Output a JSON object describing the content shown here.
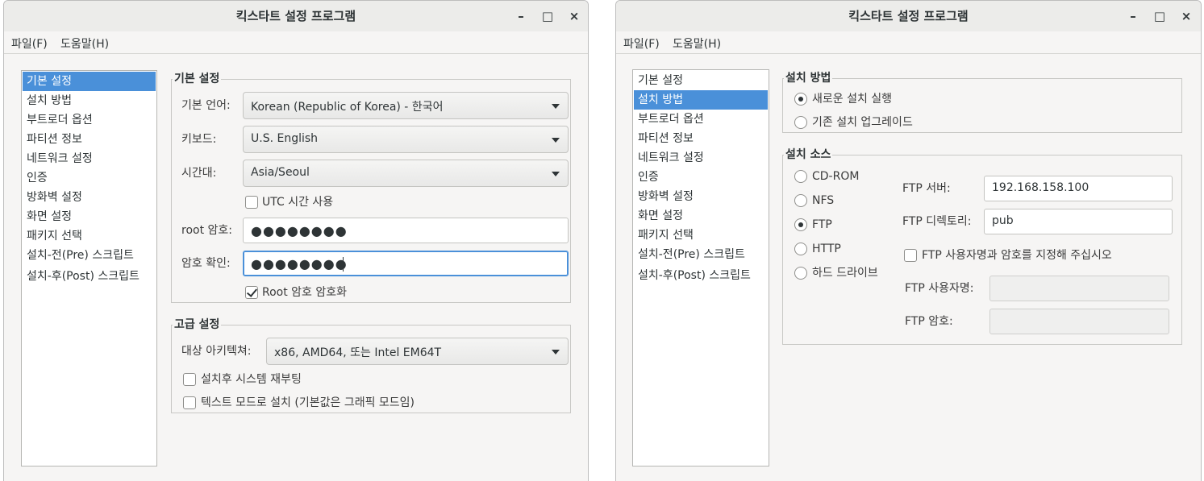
{
  "left_window": {
    "title": "킥스타트 설정 프로그램",
    "controls": {
      "minimize": "–",
      "maximize": "□",
      "close": "×"
    },
    "menu": [
      "파일(F)",
      "도움말(H)"
    ],
    "sidebar": [
      {
        "label": "기본 설정",
        "selected": true
      },
      {
        "label": "설치 방법"
      },
      {
        "label": "부트로더 옵션"
      },
      {
        "label": "파티션 정보"
      },
      {
        "label": "네트워크 설정"
      },
      {
        "label": "인증"
      },
      {
        "label": "방화벽 설정"
      },
      {
        "label": "화면 설정"
      },
      {
        "label": "패키지 선택"
      },
      {
        "label": "설치-전(Pre) 스크립트"
      },
      {
        "label": "설치-후(Post) 스크립트"
      }
    ],
    "basic": {
      "title": "기본 설정",
      "language_label": "기본 언어:",
      "language_value": "Korean (Republic of Korea) - 한국어",
      "keyboard_label": "키보드:",
      "keyboard_value": "U.S. English",
      "timezone_label": "시간대:",
      "timezone_value": "Asia/Seoul",
      "utc_label": "UTC 시간 사용",
      "utc_checked": false,
      "root_pw_label": "root 암호:",
      "root_pw_value": "●●●●●●●●",
      "confirm_pw_label": "암호 확인:",
      "confirm_pw_value": "●●●●●●●●",
      "encrypt_label": "Root 암호 암호화",
      "encrypt_checked": true
    },
    "advanced": {
      "title": "고급 설정",
      "arch_label": "대상 아키텍쳐:",
      "arch_value": "x86, AMD64, 또는 Intel EM64T",
      "reboot_label": "설치후 시스템 재부팅",
      "reboot_checked": false,
      "text_mode_label": "텍스트 모드로 설치 (기본값은 그래픽 모드임)",
      "text_mode_checked": false
    }
  },
  "right_window": {
    "title": "킥스타트 설정 프로그램",
    "controls": {
      "minimize": "–",
      "maximize": "□",
      "close": "×"
    },
    "menu": [
      "파일(F)",
      "도움말(H)"
    ],
    "sidebar": [
      {
        "label": "기본 설정"
      },
      {
        "label": "설치 방법",
        "selected": true
      },
      {
        "label": "부트로더 옵션"
      },
      {
        "label": "파티션 정보"
      },
      {
        "label": "네트워크 설정"
      },
      {
        "label": "인증"
      },
      {
        "label": "방화벽 설정"
      },
      {
        "label": "화면 설정"
      },
      {
        "label": "패키지 선택"
      },
      {
        "label": "설치-전(Pre) 스크립트"
      },
      {
        "label": "설치-후(Post) 스크립트"
      }
    ],
    "method": {
      "title": "설치 방법",
      "options": [
        "새로운 설치 실행",
        "기존 설치 업그레이드"
      ],
      "selected": "새로운 설치 실행"
    },
    "source": {
      "title": "설치 소스",
      "options": [
        "CD-ROM",
        "NFS",
        "FTP",
        "HTTP",
        "하드 드라이브"
      ],
      "selected": "FTP",
      "ftp_server_label": "FTP 서버:",
      "ftp_server_value": "192.168.158.100",
      "ftp_dir_label": "FTP 디렉토리:",
      "ftp_dir_value": "pub",
      "specify_user_label": "FTP 사용자명과 암호를 지정해 주십시오",
      "specify_user_checked": false,
      "ftp_user_label": "FTP 사용자명:",
      "ftp_user_value": "",
      "ftp_pw_label": "FTP 암호:",
      "ftp_pw_value": ""
    }
  }
}
